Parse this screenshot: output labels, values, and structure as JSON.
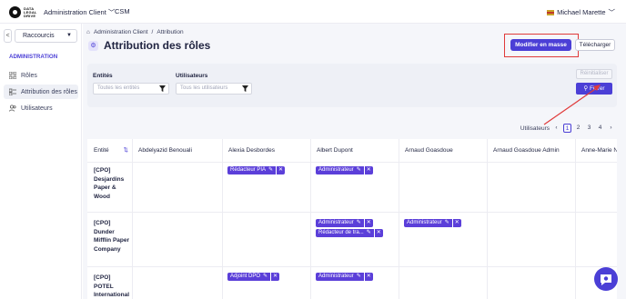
{
  "topbar": {
    "logo_text": "DATA LEGAL DRIVE",
    "client_menu": "Administration Client",
    "csm": "CSM",
    "user_name": "Michael Marette"
  },
  "sidebar": {
    "collapse": "<",
    "shortcut_label": "Raccourcis",
    "section": "ADMINISTRATION",
    "items": [
      {
        "label": "Rôles"
      },
      {
        "label": "Attribution des rôles"
      },
      {
        "label": "Utilisateurs"
      }
    ]
  },
  "breadcrumb": {
    "home": "Administration Client",
    "sep": "/",
    "current": "Attribution"
  },
  "page_title": "Attribution des rôles",
  "actions": {
    "bulk_edit": "Modifier en masse",
    "download": "Télécharger"
  },
  "filters": {
    "entities_label": "Entités",
    "entities_placeholder": "Toutes les entités",
    "users_label": "Utilisateurs",
    "users_placeholder": "Tous les utilisateurs",
    "reset": "Réinitialiser",
    "filter": "Filtrer"
  },
  "pagination": {
    "label": "Utilisateurs",
    "pages": [
      "1",
      "2",
      "3",
      "4"
    ],
    "current": "1"
  },
  "table": {
    "entity_header": "Entité",
    "columns": [
      "Abdelyazid Benouali",
      "Alexia Desbordes",
      "Albert Dupont",
      "Arnaud Goasdoue",
      "Arnaud Goasdoue Admin",
      "Anne-Marie N"
    ],
    "rows": [
      {
        "entity": "[CPO] Desjardins Paper & Wood",
        "roles": {
          "alexia": [
            "Rédacteur PIA"
          ],
          "albert": [
            "Administrateur"
          ]
        }
      },
      {
        "entity": "[CPO] Dunder Mifflin Paper Company",
        "roles": {
          "albert": [
            "Administrateur",
            "Rédacteur de tra..."
          ],
          "arnaud": [
            "Administrateur"
          ]
        }
      },
      {
        "entity": "[CPO] POTEL International",
        "roles": {
          "alexia": [
            "Adjoint DPO"
          ],
          "albert": [
            "Administrateur"
          ]
        }
      }
    ]
  },
  "colors": {
    "accent": "#4b3fd6",
    "highlight": "#e03a3a"
  }
}
